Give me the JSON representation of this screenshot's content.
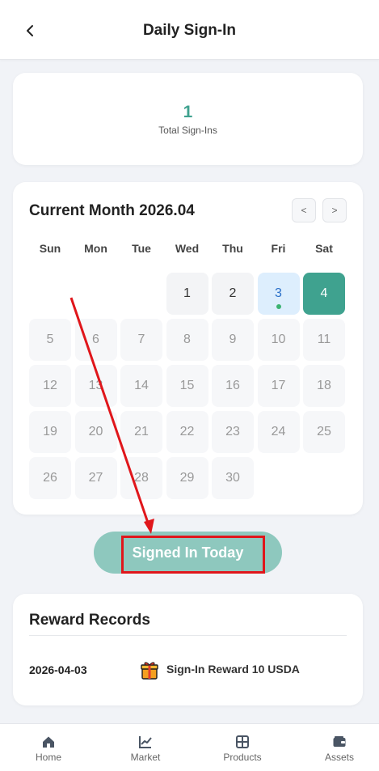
{
  "header": {
    "title": "Daily Sign-In",
    "back_icon": "chevron-left-icon"
  },
  "summary": {
    "count": "1",
    "label": "Total Sign-Ins"
  },
  "calendar": {
    "title": "Current Month 2026.04",
    "prev_label": "<",
    "next_label": ">",
    "weekdays": [
      "Sun",
      "Mon",
      "Tue",
      "Wed",
      "Thu",
      "Fri",
      "Sat"
    ],
    "days": [
      "1",
      "2",
      "3",
      "4",
      "5",
      "6",
      "7",
      "8",
      "9",
      "10",
      "11",
      "12",
      "13",
      "14",
      "15",
      "16",
      "17",
      "18",
      "19",
      "20",
      "21",
      "22",
      "23",
      "24",
      "25",
      "26",
      "27",
      "28",
      "29",
      "30"
    ],
    "signed_days": [
      "3"
    ],
    "today": "4",
    "colors": {
      "accent": "#3fa28f",
      "signed": "#ddeefd",
      "dot": "#3cb371"
    }
  },
  "sign_button": {
    "label": "Signed In Today",
    "highlight_color": "#e0161b"
  },
  "records": {
    "title": "Reward Records",
    "items": [
      {
        "date": "2026-04-03",
        "icon": "gift-icon",
        "description": "Sign-In Reward 10 USDA"
      }
    ]
  },
  "tabbar": {
    "items": [
      {
        "label": "Home",
        "icon": "home-icon"
      },
      {
        "label": "Market",
        "icon": "chart-icon"
      },
      {
        "label": "Products",
        "icon": "grid-icon"
      },
      {
        "label": "Assets",
        "icon": "wallet-icon"
      }
    ]
  }
}
